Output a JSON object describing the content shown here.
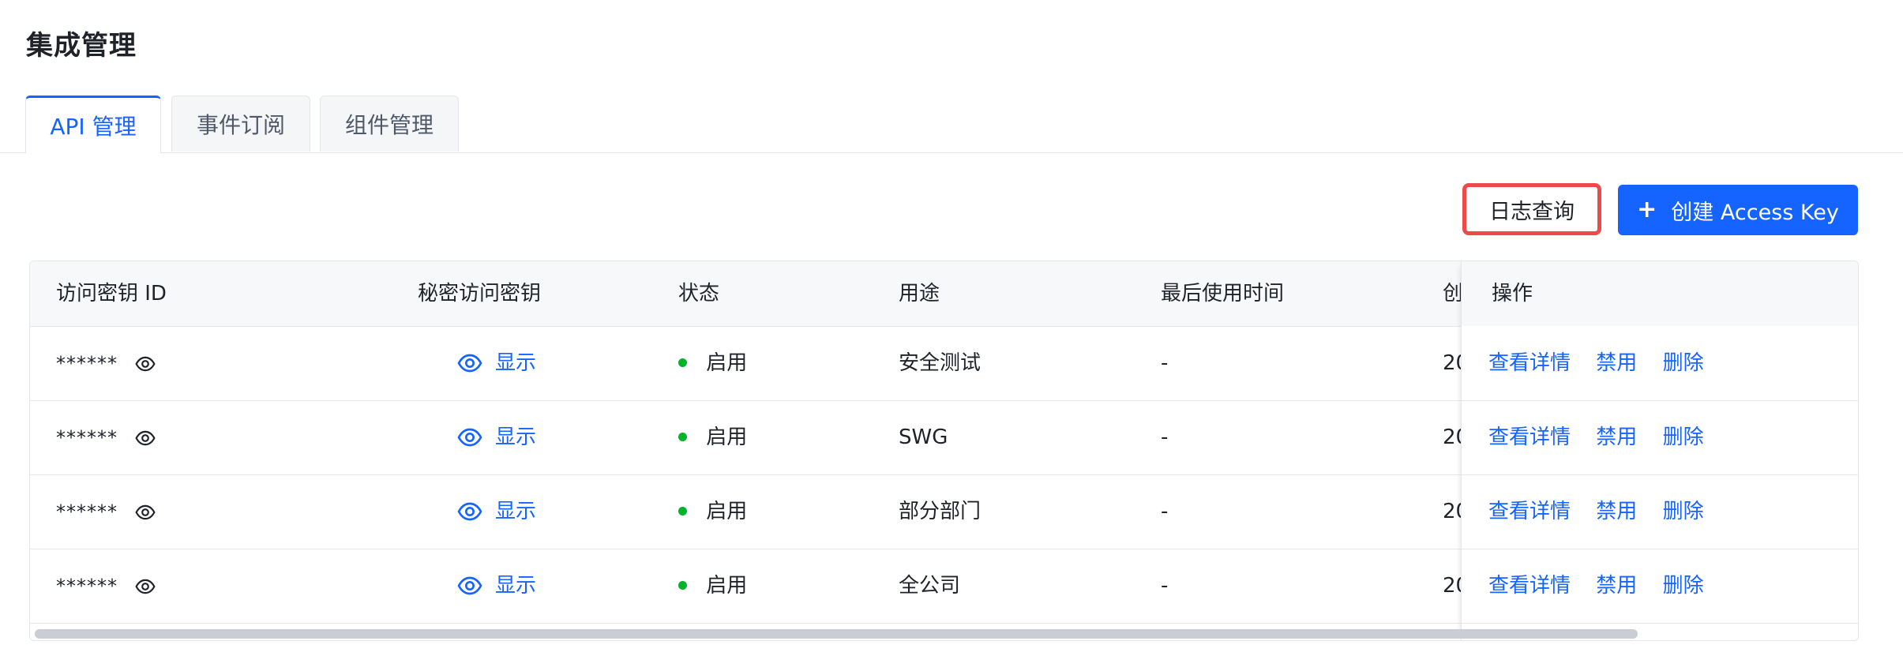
{
  "page": {
    "title": "集成管理"
  },
  "tabs": [
    {
      "label": "API 管理",
      "active": true
    },
    {
      "label": "事件订阅",
      "active": false
    },
    {
      "label": "组件管理",
      "active": false
    }
  ],
  "toolbar": {
    "log_query_label": "日志查询",
    "create_label": "创建 Access Key",
    "create_icon": "plus-icon"
  },
  "table": {
    "headers": {
      "key_id": "访问密钥 ID",
      "secret": "秘密访问密钥",
      "status": "状态",
      "usage": "用途",
      "last_used": "最后使用时间",
      "created": "创",
      "ops": "操作"
    },
    "rows": [
      {
        "key_id": "******",
        "secret_action": "显示",
        "status": "启用",
        "usage": "安全测试",
        "last_used": "-",
        "created": "20",
        "op_detail": "查看详情",
        "op_disable": "禁用",
        "op_delete": "删除"
      },
      {
        "key_id": "******",
        "secret_action": "显示",
        "status": "启用",
        "usage": "SWG",
        "last_used": "-",
        "created": "20",
        "op_detail": "查看详情",
        "op_disable": "禁用",
        "op_delete": "删除"
      },
      {
        "key_id": "******",
        "secret_action": "显示",
        "status": "启用",
        "usage": "部分部门",
        "last_used": "-",
        "created": "20",
        "op_detail": "查看详情",
        "op_disable": "禁用",
        "op_delete": "删除"
      },
      {
        "key_id": "******",
        "secret_action": "显示",
        "status": "启用",
        "usage": "全公司",
        "last_used": "-",
        "created": "20",
        "op_detail": "查看详情",
        "op_disable": "禁用",
        "op_delete": "删除"
      }
    ]
  },
  "colors": {
    "accent": "#1664ff",
    "status_enabled": "#00b42a",
    "highlight_border": "#ee4a4a"
  }
}
